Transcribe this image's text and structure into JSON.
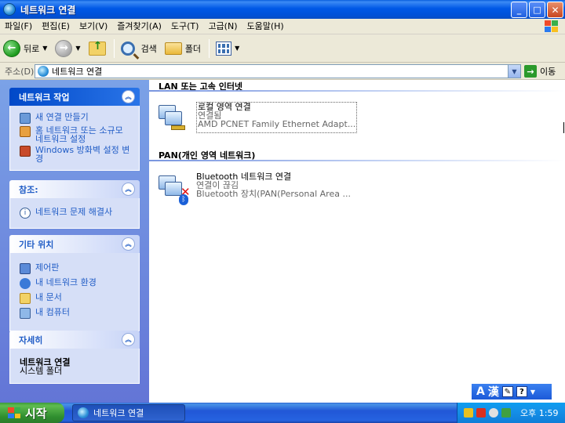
{
  "window": {
    "title": "네트워크 연결"
  },
  "menu": [
    "파일(F)",
    "편집(E)",
    "보기(V)",
    "즐겨찾기(A)",
    "도구(T)",
    "고급(N)",
    "도움말(H)"
  ],
  "toolbar": {
    "back_label": "뒤로",
    "search_label": "검색",
    "folders_label": "폴더"
  },
  "address": {
    "label": "주소(D)",
    "value": "네트워크 연결",
    "go_label": "이동"
  },
  "taskpane": {
    "network_tasks": {
      "title": "네트워크 작업",
      "items": [
        "새 연결 만들기",
        "홈 네트워크 또는 소규모 네트워크 설정",
        "Windows 방화벽 설정 변경"
      ]
    },
    "see_also": {
      "title": "참조:",
      "items": [
        "네트워크 문제 해결사"
      ]
    },
    "other_places": {
      "title": "기타 위치",
      "items": [
        "제어판",
        "내 네트워크 환경",
        "내 문서",
        "내 컴퓨터"
      ]
    },
    "details": {
      "title": "자세히",
      "name": "네트워크 연결",
      "type": "시스템 폴더"
    }
  },
  "groups": [
    {
      "title": "LAN 또는 고속 인터넷",
      "items": [
        {
          "name": "로컬 영역 연결",
          "status": "연결됨",
          "device": "AMD PCNET Family Ethernet Adapt..."
        }
      ]
    },
    {
      "title": "PAN(개인 영역 네트워크)",
      "items": [
        {
          "name": "Bluetooth 네트워크 연결",
          "status": "연결이 끊김",
          "device": "Bluetooth 장치(PAN(Personal Area ..."
        }
      ]
    }
  ],
  "langbar": {
    "lang": "A",
    "hanja": "漢"
  },
  "taskbar": {
    "start_label": "시작",
    "window_label": "네트워크 연결",
    "clock": "오후 1:59"
  }
}
